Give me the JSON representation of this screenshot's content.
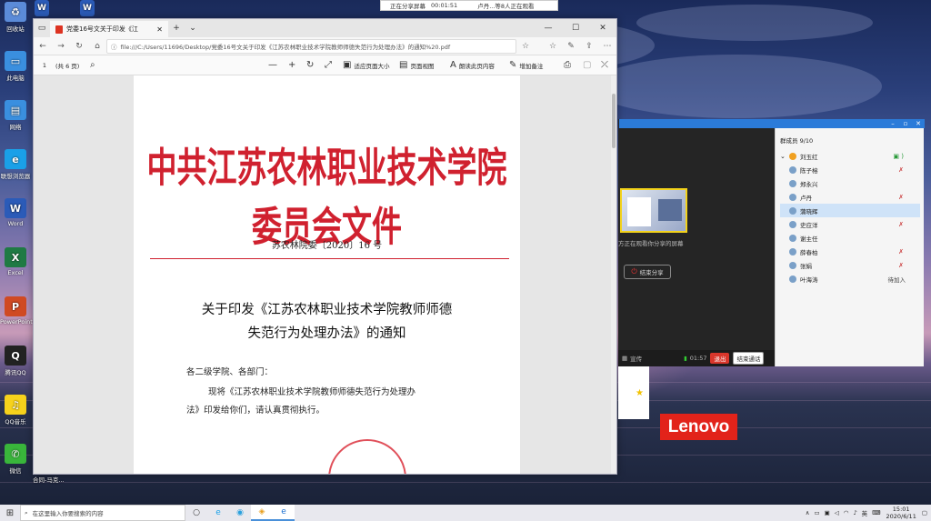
{
  "share_bar": {
    "status": "正在分享屏幕",
    "timer": "00:01:51",
    "viewers": "卢丹...等8人正在观看"
  },
  "desktop_icons": [
    {
      "label": "回收站",
      "icon": "recycle-bin-icon",
      "color": "#5b8bd8"
    },
    {
      "label": "此电脑",
      "icon": "computer-icon",
      "color": "#3a8fdf"
    },
    {
      "label": "网络",
      "icon": "network-icon",
      "color": "#3a8fdf"
    },
    {
      "label": "联想浏览器",
      "icon": "lenovo-browser-icon",
      "color": "#1aa0e8"
    },
    {
      "label": "Word",
      "icon": "word-icon",
      "color": "#2b5bb8"
    },
    {
      "label": "Excel",
      "icon": "excel-icon",
      "color": "#1f7a44"
    },
    {
      "label": "PowerPoint",
      "icon": "powerpoint-icon",
      "color": "#d04a23"
    },
    {
      "label": "腾讯QQ",
      "icon": "qq-icon",
      "color": "#222222"
    },
    {
      "label": "QQ音乐",
      "icon": "qq-music-icon",
      "color": "#f6d21c"
    },
    {
      "label": "微信",
      "icon": "wechat-icon",
      "color": "#39b53b"
    }
  ],
  "desktop_extra": {
    "label": "合同-马克..."
  },
  "browser": {
    "tab_title": "党委16号文关于印发《江",
    "address": "file:///C:/Users/11696/Desktop/党委16号文关于印发《江苏农林职业技术学院教师师德失范行为处理办法》的通知%20.pdf",
    "page_num": "1",
    "page_total": "(共 6 页)",
    "tools": {
      "fit": "适应页面大小",
      "page_view": "页面视图",
      "read_aloud": "朗读此页内容",
      "add_note": "增加备注"
    }
  },
  "document": {
    "red_header": "中共江苏农林职业技术学院委员会文件",
    "doc_number": "苏农林院委〔2020〕16 号",
    "title_line1": "关于印发《江苏农林职业技术学院教师师德",
    "title_line2": "失范行为处理办法》的通知",
    "salutation": "各二级学院、各部门：",
    "body_line1": "现将《江苏农林职业技术学院教师师德失范行为处理办",
    "body_line2": "法》印发给你们，请认真贯彻执行。"
  },
  "meeting": {
    "sharing_note": "方正在观看你分享的屏幕",
    "end_share": "结束分享",
    "bottom_label": "宣传",
    "timer": "01:57",
    "exit": "退出",
    "end_meeting": "结束通话"
  },
  "members_panel": {
    "count": "群成员 9/10",
    "members": [
      {
        "name": "刘玉红",
        "host": true,
        "muted": false,
        "status": ""
      },
      {
        "name": "陈子榕",
        "host": false,
        "muted": true,
        "status": ""
      },
      {
        "name": "郑永兴",
        "host": false,
        "muted": false,
        "status": ""
      },
      {
        "name": "卢丹",
        "host": false,
        "muted": true,
        "status": ""
      },
      {
        "name": "蒲晓辉",
        "host": false,
        "muted": false,
        "status": "",
        "selected": true
      },
      {
        "name": "史应洋",
        "host": false,
        "muted": true,
        "status": ""
      },
      {
        "name": "谢主任",
        "host": false,
        "muted": false,
        "status": ""
      },
      {
        "name": "薛春柏",
        "host": false,
        "muted": true,
        "status": ""
      },
      {
        "name": "张娟",
        "host": false,
        "muted": true,
        "status": ""
      },
      {
        "name": "叶海涛",
        "host": false,
        "muted": false,
        "status": "待加入"
      }
    ]
  },
  "brand": {
    "lenovo": "Lenovo"
  },
  "taskbar": {
    "search_placeholder": "在这里输入你要搜索的内容",
    "lang": "英",
    "time": "15:01",
    "date": "2020/6/11"
  }
}
